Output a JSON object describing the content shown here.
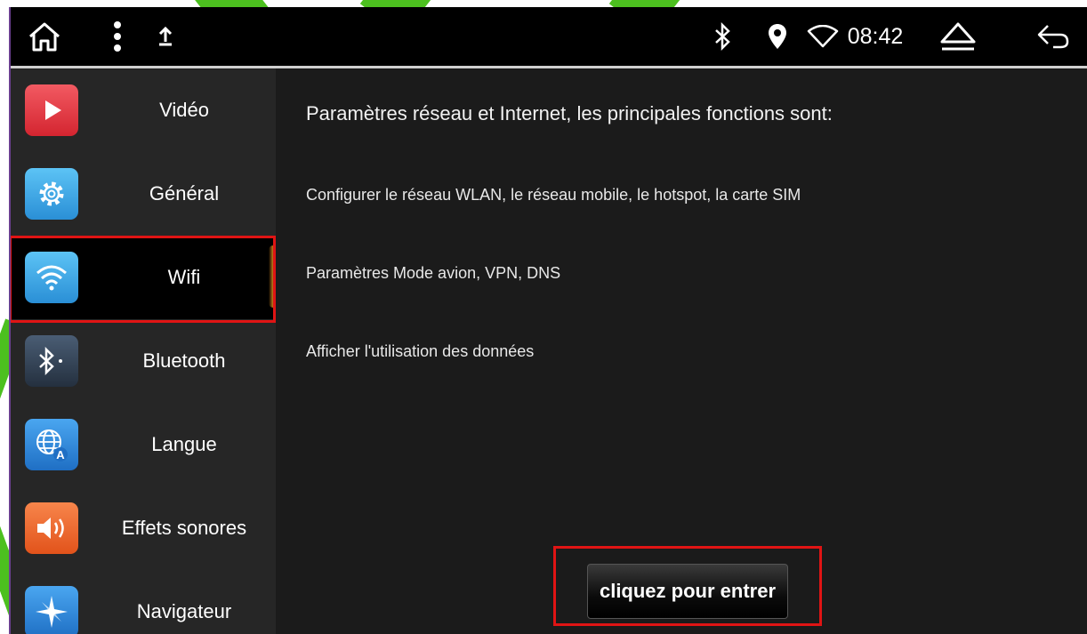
{
  "statusbar": {
    "time": "08:42",
    "icons": [
      "home-icon",
      "more-vert-icon",
      "upload-icon",
      "bluetooth-icon",
      "location-icon",
      "wifi-icon",
      "eject-icon",
      "back-icon"
    ]
  },
  "sidebar": {
    "items": [
      {
        "label": "Vidéo",
        "icon": "play-icon",
        "color": "#e8363f"
      },
      {
        "label": "Général",
        "icon": "gear-icon",
        "color": "#3aa6e8"
      },
      {
        "label": "Wifi",
        "icon": "wifi-icon",
        "color": "#3aa6e8",
        "selected": true
      },
      {
        "label": "Bluetooth",
        "icon": "bluetooth-icon",
        "color": "#34455a"
      },
      {
        "label": "Langue",
        "icon": "globe-language-icon",
        "color": "#2f8fe0"
      },
      {
        "label": "Effets sonores",
        "icon": "speaker-icon",
        "color": "#f06a2a"
      },
      {
        "label": "Navigateur",
        "icon": "compass-icon",
        "color": "#2f8fe0"
      }
    ]
  },
  "main": {
    "heading": "Paramètres réseau et Internet, les principales fonctions sont:",
    "lines": [
      "Configurer le réseau WLAN, le réseau mobile, le hotspot, la carte SIM",
      "Paramètres Mode avion, VPN, DNS",
      "Afficher l'utilisation des données"
    ],
    "enter_button": "cliquez pour entrer"
  },
  "colors": {
    "highlight": "#e01414",
    "accent_stripe": "#4cc01f"
  }
}
